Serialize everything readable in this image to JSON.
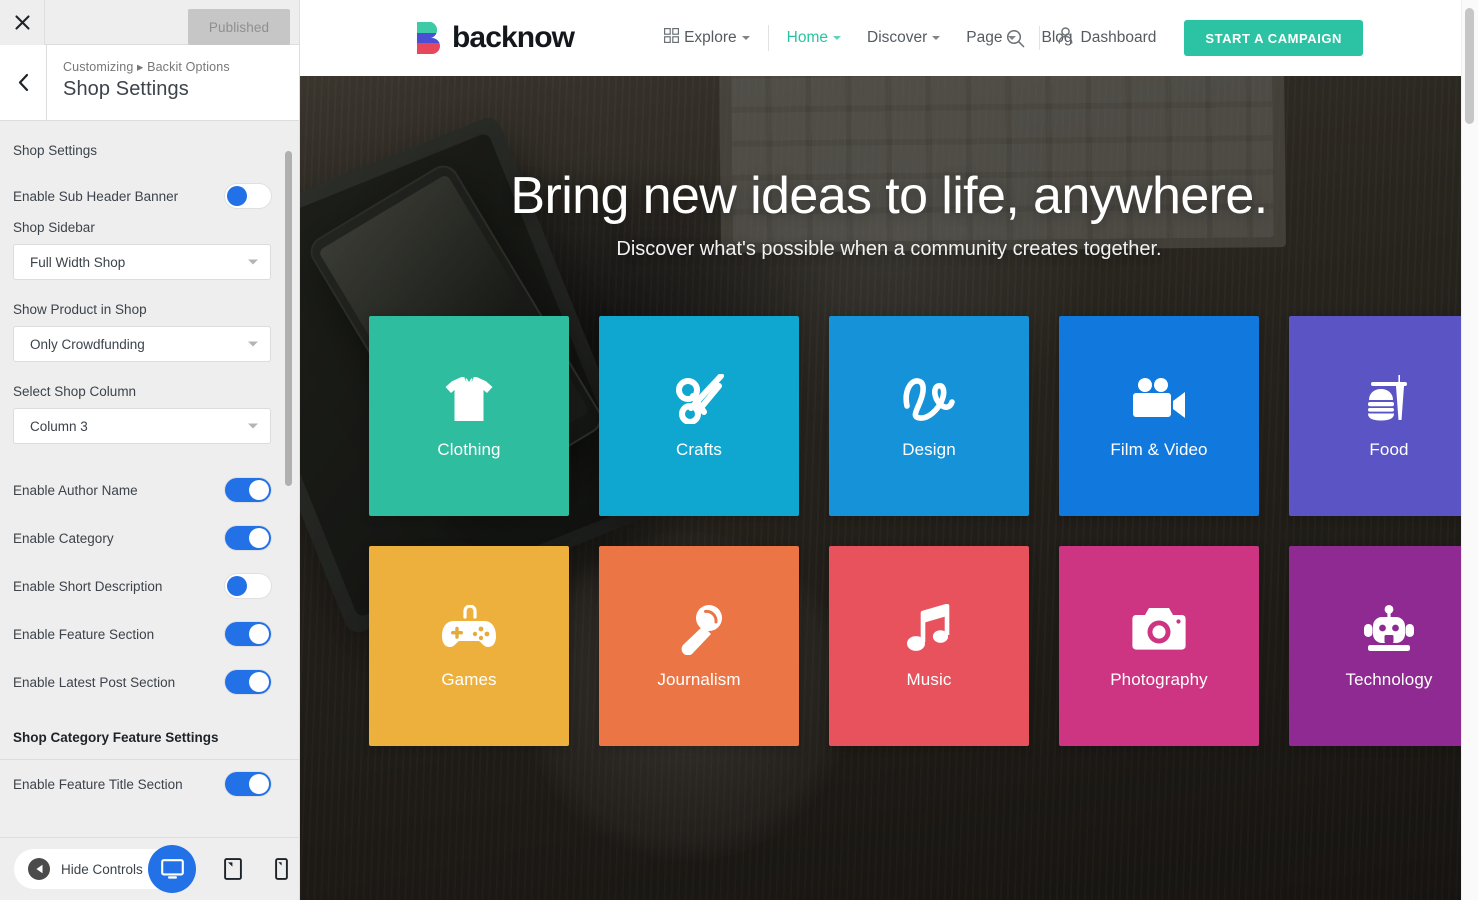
{
  "customizer": {
    "close_icon": "close-icon",
    "published_label": "Published",
    "back_icon": "chevron-left-icon",
    "breadcrumb": "Customizing ▸ Backit Options",
    "panel_title": "Shop Settings",
    "sections": [
      {
        "heading": "Shop Settings",
        "bold": false,
        "controls": [
          {
            "type": "toggle",
            "label": "Enable Sub Header Banner",
            "state": "off"
          },
          {
            "type": "select",
            "label": "Shop Sidebar",
            "value": "Full Width Shop"
          },
          {
            "type": "select",
            "label": "Show Product in Shop",
            "value": "Only Crowdfunding"
          },
          {
            "type": "select",
            "label": "Select Shop Column",
            "value": "Column 3"
          },
          {
            "type": "toggle",
            "label": "Enable Author Name",
            "state": "on"
          },
          {
            "type": "toggle",
            "label": "Enable Category",
            "state": "on"
          },
          {
            "type": "toggle",
            "label": "Enable Short Description",
            "state": "off"
          },
          {
            "type": "toggle",
            "label": "Enable Feature Section",
            "state": "on"
          },
          {
            "type": "toggle",
            "label": "Enable Latest Post Section",
            "state": "on"
          }
        ]
      },
      {
        "heading": "Shop Category Feature Settings",
        "bold": true,
        "controls": [
          {
            "type": "toggle",
            "label": "Enable Feature Title Section",
            "state": "on"
          }
        ]
      }
    ],
    "footer": {
      "hide_controls_label": "Hide Controls",
      "hide_controls_icon": "arrow-left-circle-icon",
      "devices": [
        {
          "name": "desktop-icon",
          "active": true
        },
        {
          "name": "tablet-icon",
          "active": false
        },
        {
          "name": "mobile-icon",
          "active": false
        }
      ]
    },
    "accent_color": "#2271e6"
  },
  "site": {
    "logo": {
      "text": "backnow",
      "mark_colors": [
        "#3ec9a7",
        "#4a4fd4",
        "#e8465a"
      ]
    },
    "nav": {
      "explore": {
        "label": "Explore",
        "icon": "grid-icon",
        "caret": true
      },
      "items": [
        {
          "label": "Home",
          "caret": true,
          "active": true
        },
        {
          "label": "Discover",
          "caret": true,
          "active": false
        },
        {
          "label": "Page",
          "caret": true,
          "active": false
        },
        {
          "label": "Blog",
          "caret": false,
          "active": false
        }
      ]
    },
    "header_right": {
      "search_icon": "search-icon",
      "dashboard": {
        "label": "Dashboard",
        "icon": "user-icon"
      },
      "cta_label": "START A CAMPAIGN",
      "cta_color": "#2bc3a3"
    },
    "hero": {
      "title": "Bring new ideas to life, anywhere.",
      "subtitle": "Discover what's possible when a community creates together."
    },
    "categories": [
      {
        "label": "Clothing",
        "icon": "tshirt-icon",
        "color": "#2ebd9e"
      },
      {
        "label": "Crafts",
        "icon": "scissors-icon",
        "color": "#0fa7d0"
      },
      {
        "label": "Design",
        "icon": "squiggle-icon",
        "color": "#1592d8"
      },
      {
        "label": "Film & Video",
        "icon": "movie-camera-icon",
        "color": "#1179dd"
      },
      {
        "label": "Food",
        "icon": "burger-icon",
        "color": "#5b54c4"
      },
      {
        "label": "Games",
        "icon": "gamepad-icon",
        "color": "#eeb03c"
      },
      {
        "label": "Journalism",
        "icon": "microphone-icon",
        "color": "#ec7545"
      },
      {
        "label": "Music",
        "icon": "music-note-icon",
        "color": "#e8525c"
      },
      {
        "label": "Photography",
        "icon": "camera-icon",
        "color": "#cd3482"
      },
      {
        "label": "Technology",
        "icon": "robot-icon",
        "color": "#8e2a92"
      }
    ]
  }
}
